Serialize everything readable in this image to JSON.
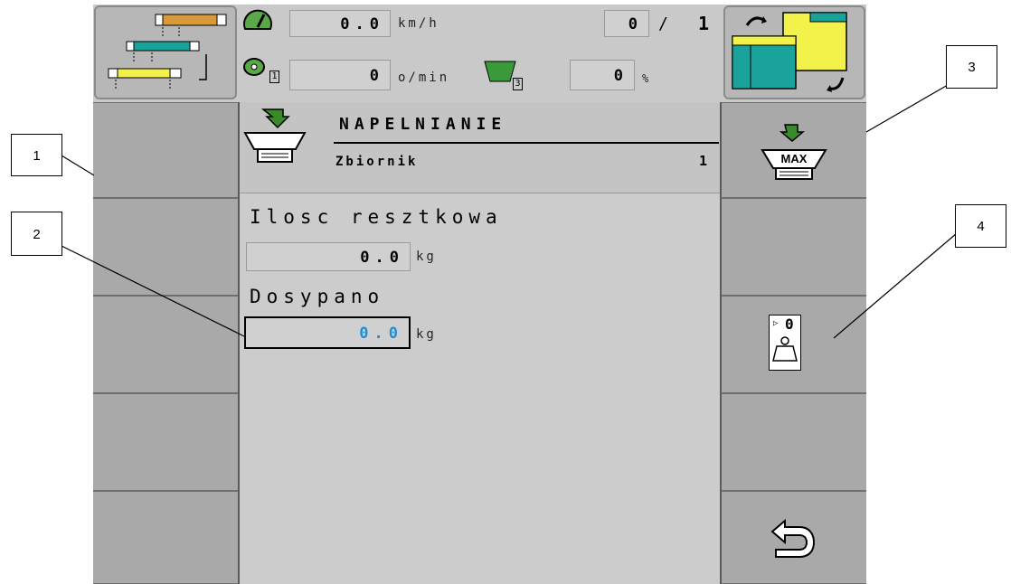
{
  "header": {
    "speed_value": "0.0",
    "speed_unit": "km/h",
    "counter_left": "0",
    "counter_sep": "/",
    "counter_right": "1",
    "rpm_value": "0",
    "rpm_unit": "o/min",
    "rpm_sub": "1",
    "hopper_sub": "3",
    "percent_value": "0",
    "percent_unit": "%"
  },
  "panel": {
    "title": "NAPELNIANIE",
    "subtitle": "Zbiornik",
    "subtitle_value": "1"
  },
  "fields": {
    "residual_label": "Ilosc resztkowa",
    "residual_value": "0.0",
    "residual_unit": "kg",
    "added_label": "Dosypano",
    "added_value": "0.0",
    "added_unit": "kg"
  },
  "softkeys": {
    "max_label": "MAX",
    "tare_label": "0"
  },
  "callouts": [
    "1",
    "2",
    "3",
    "4"
  ],
  "colors": {
    "screen_bg": "#c9c9c9",
    "softkey_bg": "#a9a9a9",
    "active_value": "#1e8ed6",
    "arrow_green": "#3a8a2a",
    "teal": "#1aa39a",
    "yellow": "#f2f24a",
    "orange": "#d89a3a"
  }
}
